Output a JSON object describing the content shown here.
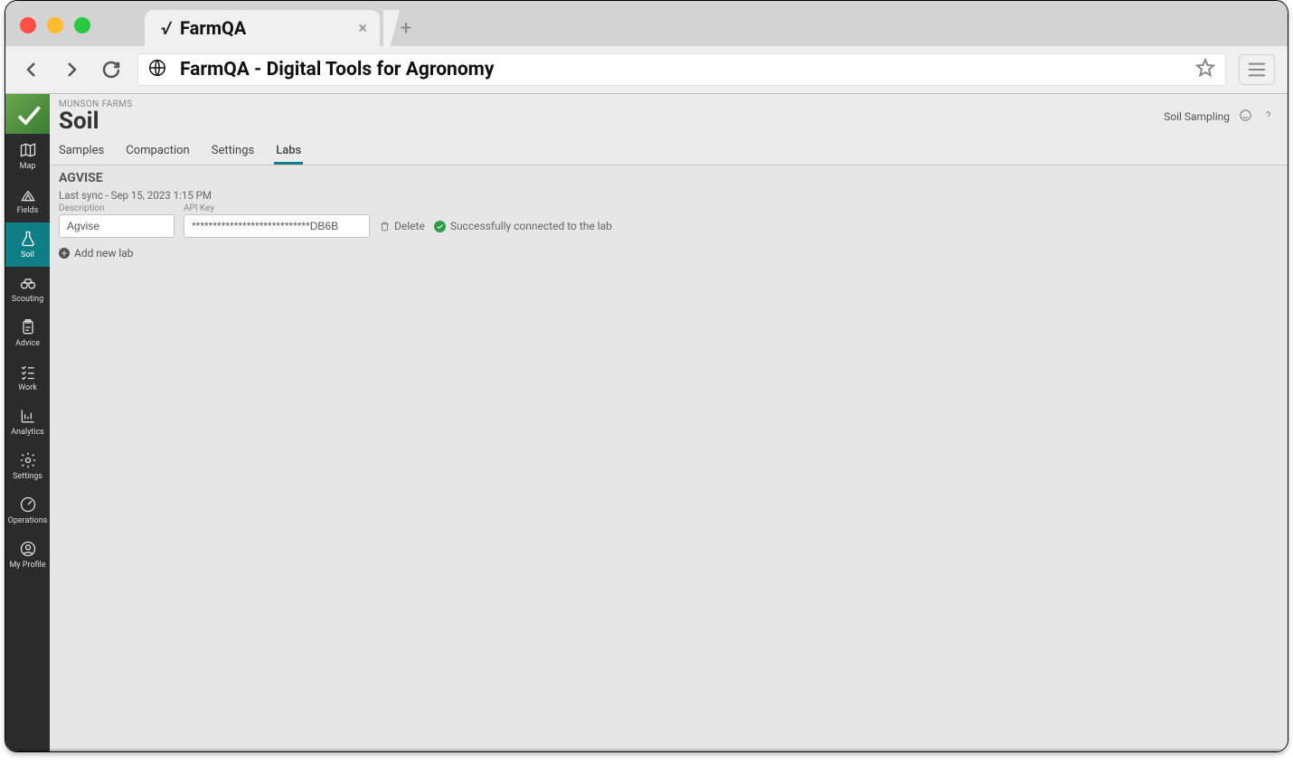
{
  "browser": {
    "tab_title": "FarmQA",
    "url_bar_text": "FarmQA - Digital Tools for Agronomy"
  },
  "sidebar": {
    "items": [
      {
        "label": "Map"
      },
      {
        "label": "Fields"
      },
      {
        "label": "Soil"
      },
      {
        "label": "Scouting"
      },
      {
        "label": "Advice"
      },
      {
        "label": "Work"
      },
      {
        "label": "Analytics"
      },
      {
        "label": "Settings"
      },
      {
        "label": "Operations"
      },
      {
        "label": "My Profile"
      }
    ]
  },
  "header": {
    "org": "MUNSON FARMS",
    "title": "Soil",
    "right_label": "Soil Sampling",
    "tabs": [
      {
        "label": "Samples"
      },
      {
        "label": "Compaction"
      },
      {
        "label": "Settings"
      },
      {
        "label": "Labs"
      }
    ]
  },
  "lab": {
    "name": "AGVISE",
    "last_sync": "Last sync - Sep 15, 2023 1:15 PM",
    "description_label": "Description",
    "description_value": "Agvise",
    "apikey_label": "API Key",
    "apikey_value": "****************************DB6B",
    "delete_label": "Delete",
    "status_text": "Successfully connected to the lab",
    "add_new_lab": "Add new lab"
  }
}
